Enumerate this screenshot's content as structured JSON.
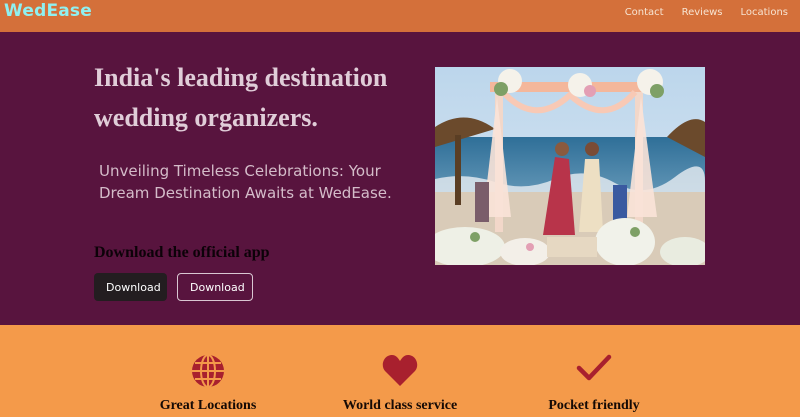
{
  "nav": {
    "brand": "WedEase",
    "links": [
      "Contact",
      "Reviews",
      "Locations"
    ]
  },
  "hero": {
    "headline": "India's leading destination wedding organizers.",
    "subtitle": "Unveiling Timeless Celebrations: Your Dream Destination Awaits at WedEase.",
    "app_heading": "Download the official app",
    "buttons": [
      {
        "label": "Download",
        "icon": "apple-icon"
      },
      {
        "label": "Download",
        "icon": "google-play-icon"
      }
    ]
  },
  "features": [
    {
      "title": "Great Locations",
      "icon": "globe-icon"
    },
    {
      "title": "World class service",
      "icon": "heart-icon"
    },
    {
      "title": "Pocket friendly",
      "icon": "checkmark-icon"
    }
  ],
  "colors": {
    "navbar": "#d4703a",
    "brand": "#8ff0f0",
    "hero_bg": "#58143e",
    "features_bg": "#f49a4a",
    "feature_icon": "#a8202e"
  }
}
